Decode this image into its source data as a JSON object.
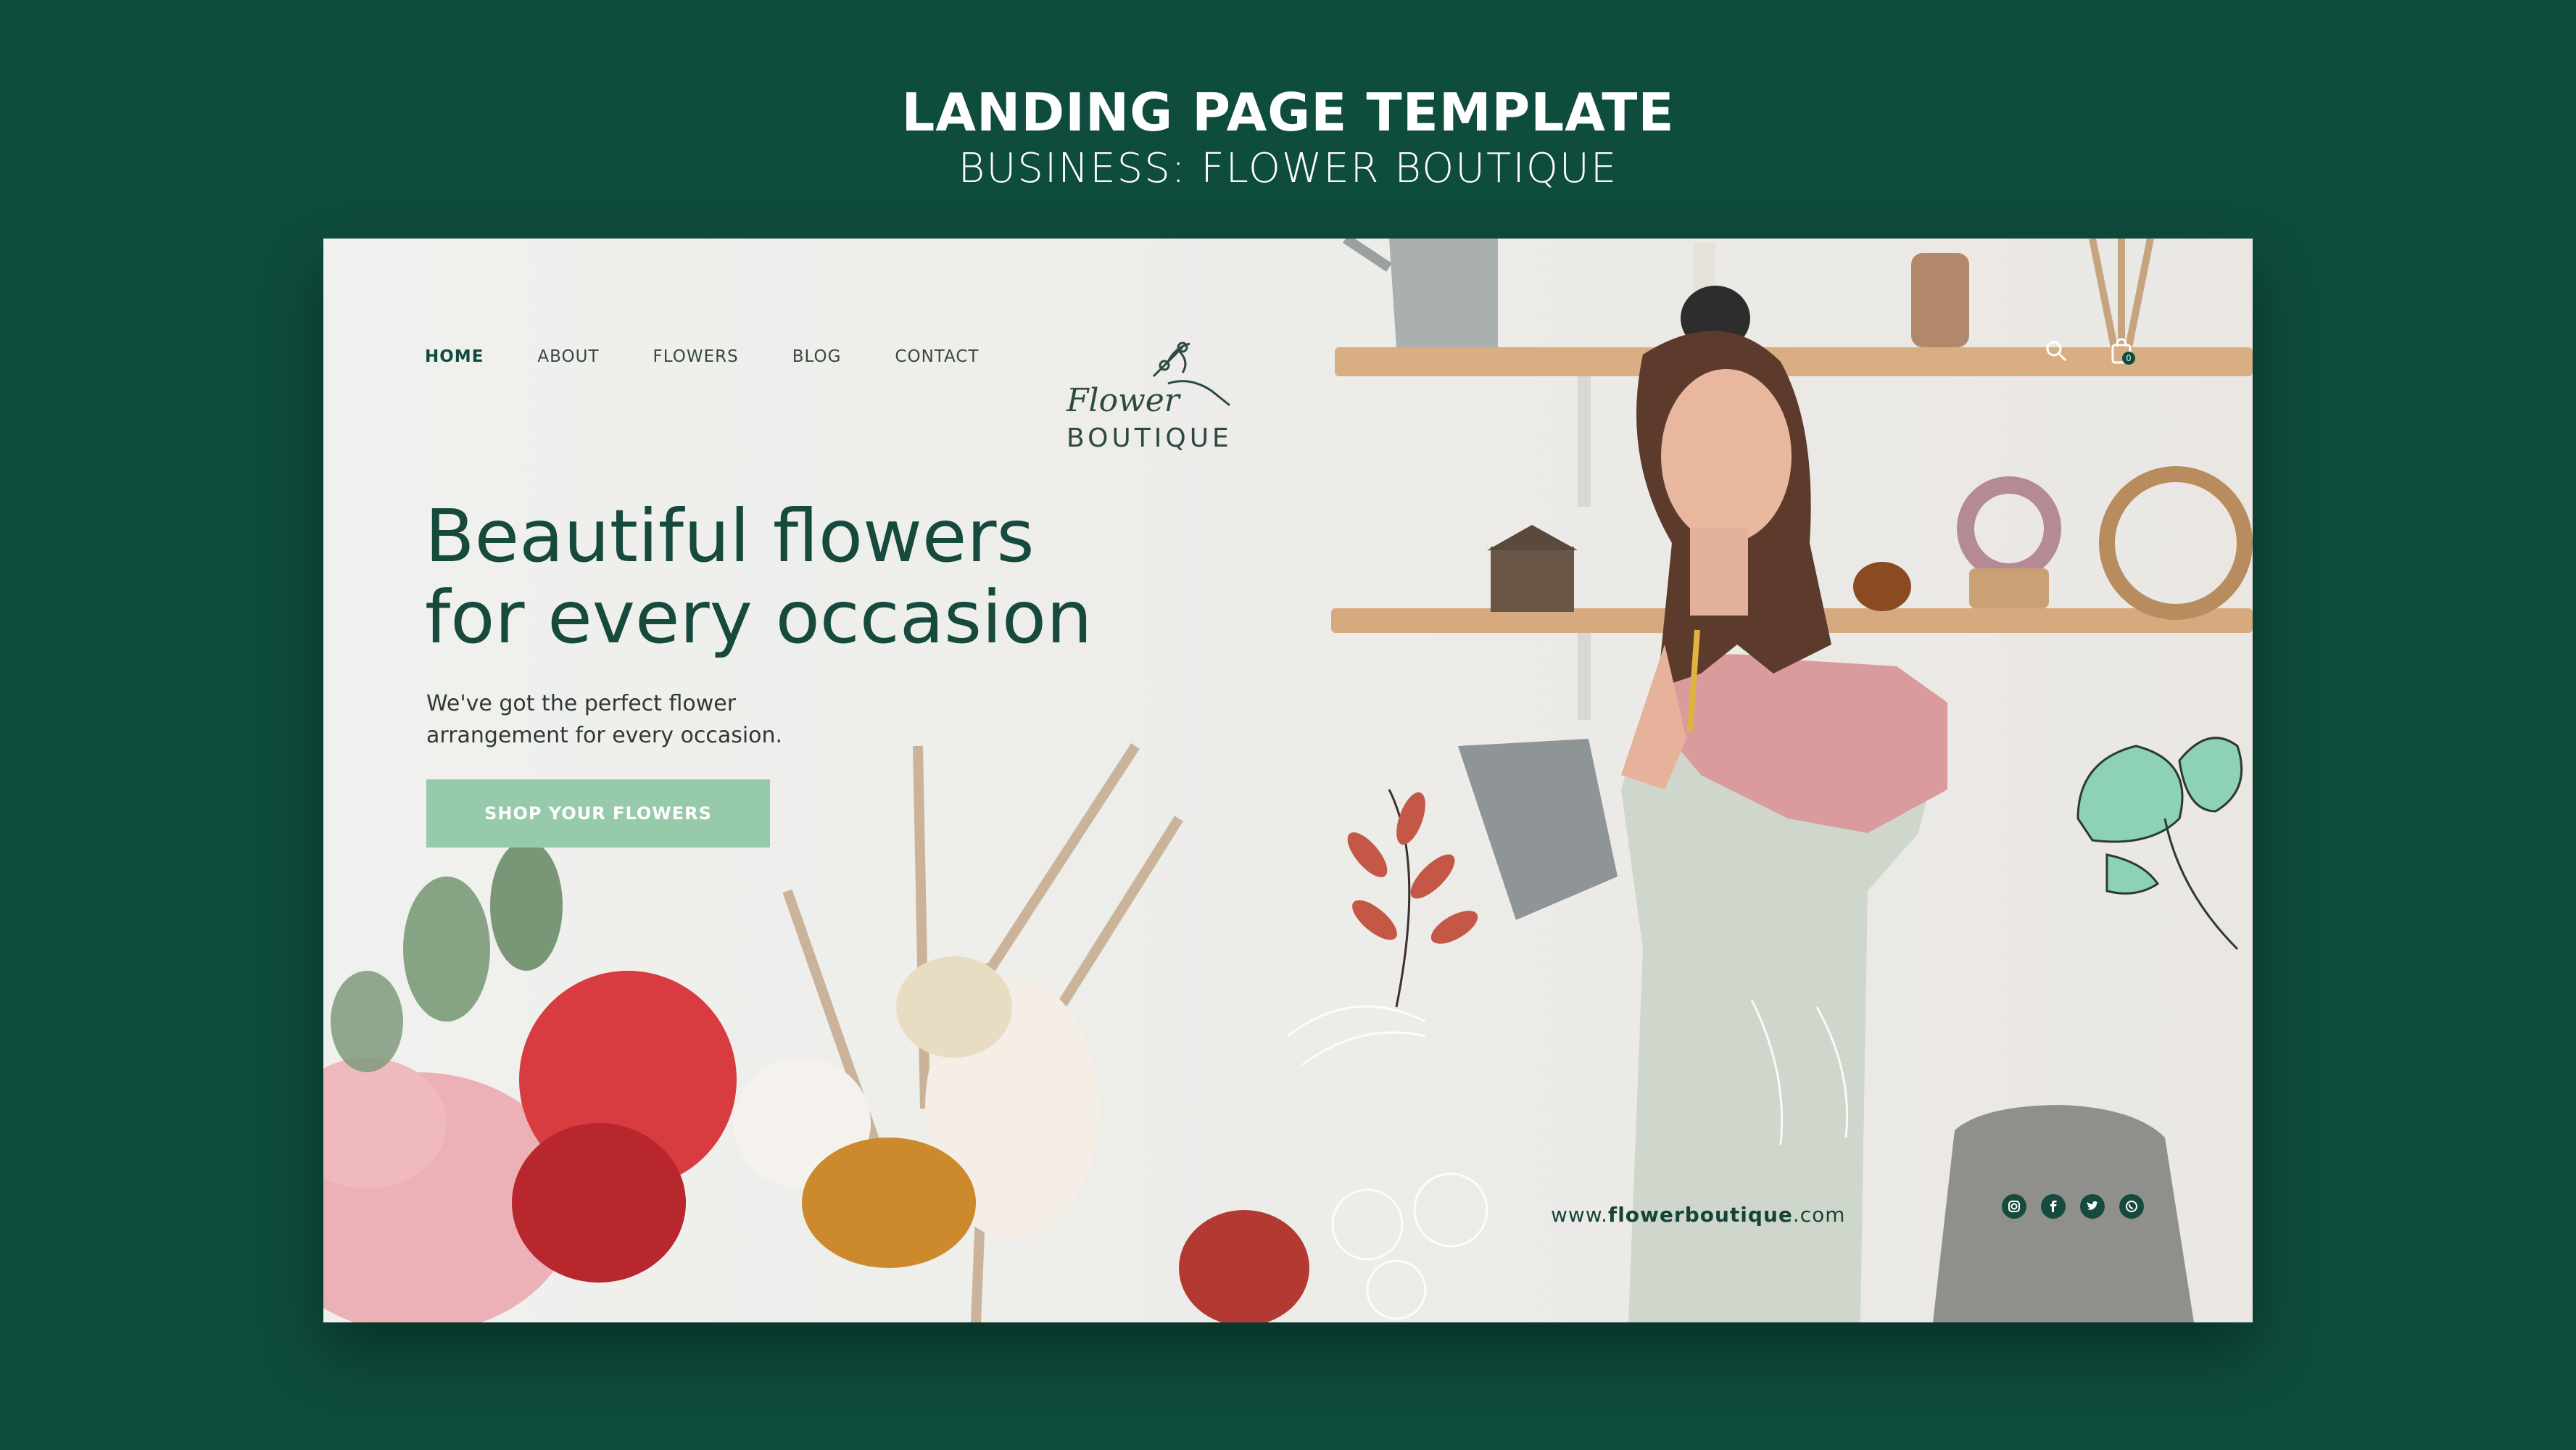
{
  "header": {
    "title": "LANDING PAGE TEMPLATE",
    "subtitle": "BUSINESS: FLOWER BOUTIQUE"
  },
  "nav": {
    "items": [
      {
        "label": "HOME",
        "active": true
      },
      {
        "label": "ABOUT",
        "active": false
      },
      {
        "label": "FLOWERS",
        "active": false
      },
      {
        "label": "BLOG",
        "active": false
      },
      {
        "label": "CONTACT",
        "active": false
      }
    ]
  },
  "logo": {
    "script": "Flower",
    "word": "BOUTIQUE"
  },
  "hero": {
    "title_line1": "Beautiful flowers",
    "title_line2": "for every occasion",
    "text_line1": "We've got the perfect flower",
    "text_line2": "arrangement for every occasion.",
    "cta_label": "SHOP YOUR FLOWERS"
  },
  "header_icons": {
    "search": "search-icon",
    "cart": "shopping-bag-icon",
    "cart_count": "0"
  },
  "footer": {
    "website_prefix": "www.",
    "website_name": "flowerboutique",
    "website_suffix": ".com",
    "socials": [
      "instagram-icon",
      "facebook-icon",
      "twitter-icon",
      "whatsapp-icon"
    ]
  },
  "colors": {
    "background": "#0e4c3e",
    "accent": "#97c9ab",
    "text_dark": "#164a3c"
  }
}
